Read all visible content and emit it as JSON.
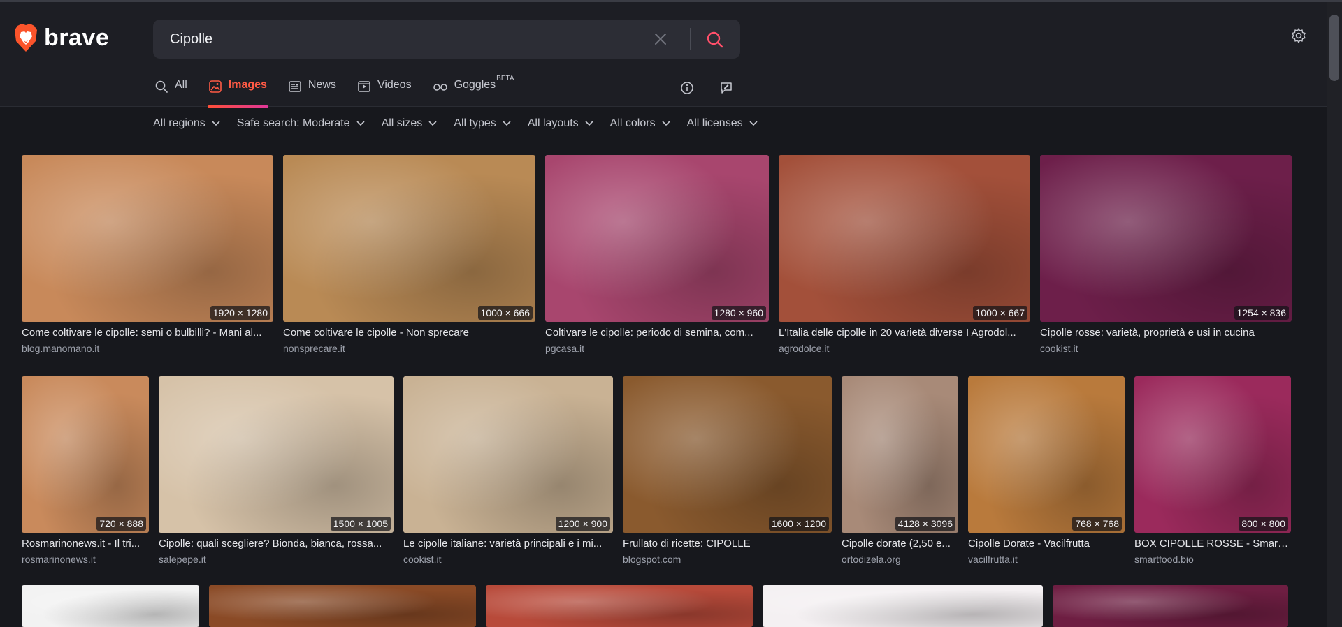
{
  "brand": {
    "logo_text": "brave",
    "accent": "#fb542b"
  },
  "search": {
    "query": "Cipolle"
  },
  "tabs": [
    {
      "label": "All",
      "icon": "search-icon"
    },
    {
      "label": "Images",
      "icon": "image-icon",
      "active": true
    },
    {
      "label": "News",
      "icon": "newspaper-icon"
    },
    {
      "label": "Videos",
      "icon": "video-icon"
    },
    {
      "label": "Goggles",
      "badge": "BETA",
      "icon": "goggles-icon"
    }
  ],
  "filters": [
    "All regions",
    "Safe search: Moderate",
    "All sizes",
    "All types",
    "All layouts",
    "All colors",
    "All licenses"
  ],
  "results": {
    "row1": [
      {
        "dims": "1920 × 1280",
        "title": "Come coltivare le cipolle: semi o bulbilli? - Mani al...",
        "source": "blog.manomano.it",
        "color": "#c8895a"
      },
      {
        "dims": "1000 × 666",
        "title": "Come coltivare le cipolle - Non sprecare",
        "source": "nonsprecare.it",
        "color": "#b98a55"
      },
      {
        "dims": "1280 × 960",
        "title": "Coltivare le cipolle: periodo di semina, com...",
        "source": "pgcasa.it",
        "color": "#a8466e"
      },
      {
        "dims": "1000 × 667",
        "title": "L'Italia delle cipolle in 20 varietà diverse I Agrodol...",
        "source": "agrodolce.it",
        "color": "#a3503a"
      },
      {
        "dims": "1254 × 836",
        "title": "Cipolle rosse: varietà, proprietà e usi in cucina",
        "source": "cookist.it",
        "color": "#6d1f4a"
      }
    ],
    "row2": [
      {
        "dims": "720 × 888",
        "title": "Rosmarinonews.it - Il tri...",
        "source": "rosmarinonews.it",
        "color": "#c98a5c"
      },
      {
        "dims": "1500 × 1005",
        "title": "Cipolle: quali scegliere? Bionda, bianca, rossa...",
        "source": "salepepe.it",
        "color": "#d6c2a8"
      },
      {
        "dims": "1200 × 900",
        "title": "Le cipolle italiane: varietà principali e i mi...",
        "source": "cookist.it",
        "color": "#c9b294"
      },
      {
        "dims": "1600 × 1200",
        "title": "Frullato di ricette: CIPOLLE",
        "source": "blogspot.com",
        "color": "#8a5a2e"
      },
      {
        "dims": "4128 × 3096",
        "title": "Cipolle dorate (2,50 e...",
        "source": "ortodizela.org",
        "color": "#a88a78"
      },
      {
        "dims": "768 × 768",
        "title": "Cipolle Dorate - Vacilfrutta",
        "source": "vacilfrutta.it",
        "color": "#b97a3c"
      },
      {
        "dims": "800 × 800",
        "title": "BOX CIPOLLE ROSSE - Smart F...",
        "source": "smartfood.bio",
        "color": "#9b2a5c"
      }
    ],
    "row3": [
      {
        "color": "#f2f2f2"
      },
      {
        "color": "#8a4a26"
      },
      {
        "color": "#b84a3a"
      },
      {
        "color": "#f4f0f2"
      },
      {
        "color": "#6e1e42"
      }
    ]
  }
}
